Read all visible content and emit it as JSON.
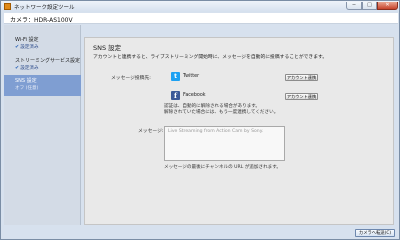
{
  "window": {
    "title": "ネットワーク設定ツール",
    "minimize_glyph": "─",
    "maximize_glyph": "□",
    "close_glyph": "✕"
  },
  "camera": {
    "label": "カメラ：HDR-AS100V"
  },
  "sidebar": {
    "items": [
      {
        "label": "Wi-Fi 設定",
        "status": "設定済み",
        "checked": true,
        "active": false
      },
      {
        "label": "ストリーミングサービス設定",
        "status": "設定済み",
        "checked": true,
        "active": false
      },
      {
        "label": "SNS 設定",
        "status": "オフ (任意)",
        "checked": false,
        "active": true
      }
    ]
  },
  "main": {
    "title": "SNS 設定",
    "description": "アカウントと連携すると、ライブストリーミング開始時に、メッセージを自動的に投稿することができます。",
    "post_label": "メッセージ投稿先:",
    "services": [
      {
        "icon": "twitter-icon",
        "glyph": "t",
        "name": "Twitter",
        "button": "アカウント連携"
      },
      {
        "icon": "facebook-icon",
        "glyph": "f",
        "name": "Facebook",
        "button": "アカウント連携"
      }
    ],
    "auth_note_1": "認証は、自動的に解除される場合があります。",
    "auth_note_2": "解除されていた場合には、もう一度連携してください。",
    "message_label": "メッセージ:",
    "message_placeholder": "Live Streaming from Action Cam by Sony.",
    "url_note": "メッセージの最後にチャンネルの URL が追加されます。"
  },
  "footer": {
    "close_label": "カメラへ転送(C)"
  },
  "colors": {
    "sidebar_active": "#7f9ed2",
    "twitter": "#1da1f2",
    "facebook": "#3b5998"
  }
}
